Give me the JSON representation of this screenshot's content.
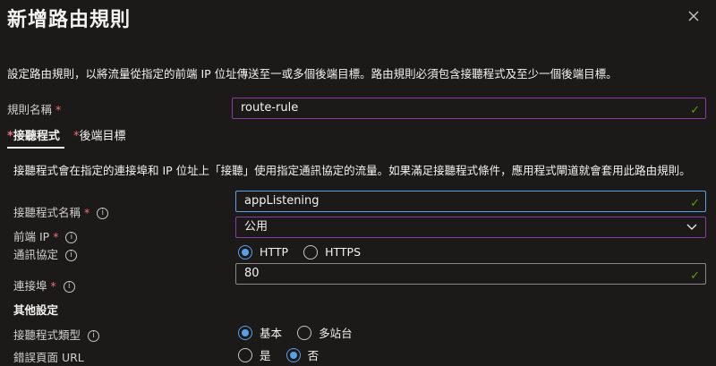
{
  "panel": {
    "title": "新增路由規則",
    "description": "設定路由規則，以將流量從指定的前端 IP 位址傳送至一或多個後端目標。路由規則必須包含接聽程式及至少一個後端目標。"
  },
  "rule_name": {
    "label": "規則名稱",
    "value": "route-rule"
  },
  "tabs": [
    {
      "label": "接聽程式",
      "selected": true
    },
    {
      "label": "後端目標",
      "selected": false
    }
  ],
  "listener": {
    "description": "接聽程式會在指定的連接埠和 IP 位址上「接聽」使用指定通訊協定的流量。如果滿足接聽程式條件，應用程式閘道就會套用此路由規則。",
    "name_label": "接聽程式名稱",
    "name_value": "appListening",
    "frontend_ip_label": "前端 IP",
    "frontend_ip_value": "公用",
    "protocol_label": "通訊協定",
    "protocol_options": [
      "HTTP",
      "HTTPS"
    ],
    "protocol_selected": "HTTP",
    "port_label": "連接埠",
    "port_value": "80"
  },
  "other_settings": {
    "heading": "其他設定",
    "listener_type_label": "接聽程式類型",
    "listener_type_options": [
      "基本",
      "多站台"
    ],
    "listener_type_selected": "基本",
    "error_page_label": "錯誤頁面 URL",
    "error_page_options": [
      "是",
      "否"
    ],
    "error_page_selected": "否"
  },
  "icons": {
    "close": "close-icon",
    "info": "info-icon",
    "check": "checkmark-icon",
    "dropdown": "chevron-down-icon"
  },
  "colors": {
    "background": "#1b1a19",
    "accent": "#5aa0e6",
    "required": "#f1707b",
    "valid": "#57a300",
    "field_border_highlight": "#8a3d9c"
  }
}
